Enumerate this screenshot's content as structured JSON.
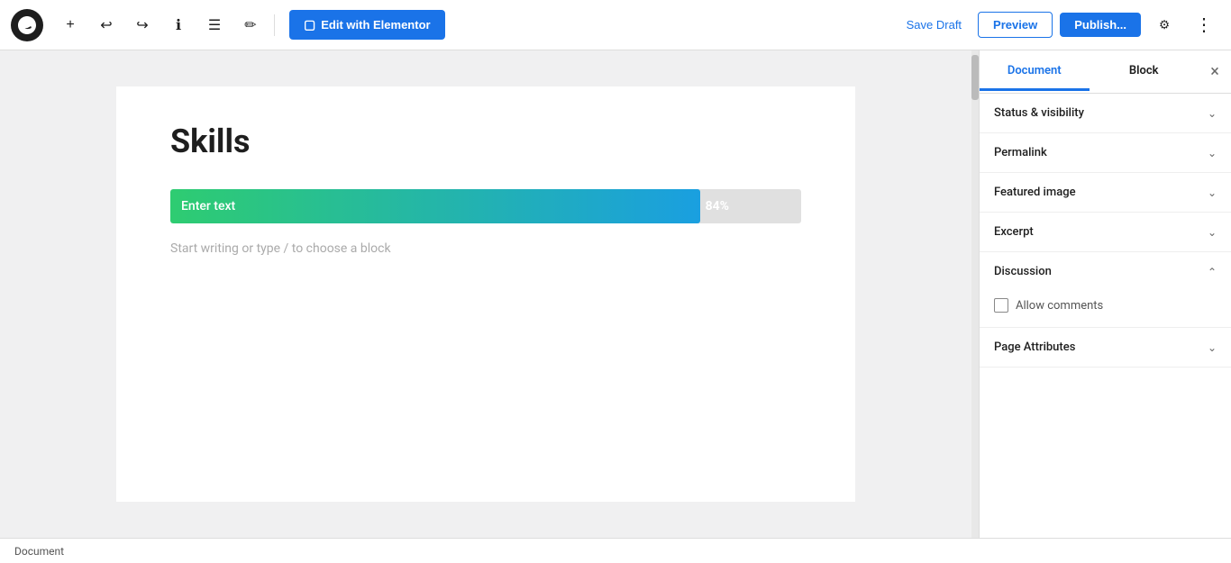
{
  "toolbar": {
    "edit_elementor_label": "Edit with Elementor",
    "save_draft_label": "Save Draft",
    "preview_label": "Preview",
    "publish_label": "Publish...",
    "icons": {
      "add": "+",
      "undo": "↩",
      "redo": "↪",
      "info": "ℹ",
      "list": "☰",
      "pen": "✏",
      "settings": "⚙",
      "more": "⋮",
      "close": "×"
    }
  },
  "editor": {
    "post_title": "Skills",
    "progress_bar": {
      "text": "Enter text",
      "percent": 84,
      "percent_label": "84%"
    },
    "placeholder": "Start writing or type / to choose a block"
  },
  "sidebar": {
    "tabs": [
      {
        "label": "Document",
        "active": true
      },
      {
        "label": "Block",
        "active": false
      }
    ],
    "sections": [
      {
        "id": "status-visibility",
        "title": "Status & visibility",
        "expanded": false
      },
      {
        "id": "permalink",
        "title": "Permalink",
        "expanded": false
      },
      {
        "id": "featured-image",
        "title": "Featured image",
        "expanded": false
      },
      {
        "id": "excerpt",
        "title": "Excerpt",
        "expanded": false
      },
      {
        "id": "discussion",
        "title": "Discussion",
        "expanded": true
      },
      {
        "id": "page-attributes",
        "title": "Page Attributes",
        "expanded": false
      }
    ],
    "discussion": {
      "allow_comments_label": "Allow comments",
      "allow_comments_checked": false
    }
  },
  "status_bar": {
    "label": "Document"
  }
}
